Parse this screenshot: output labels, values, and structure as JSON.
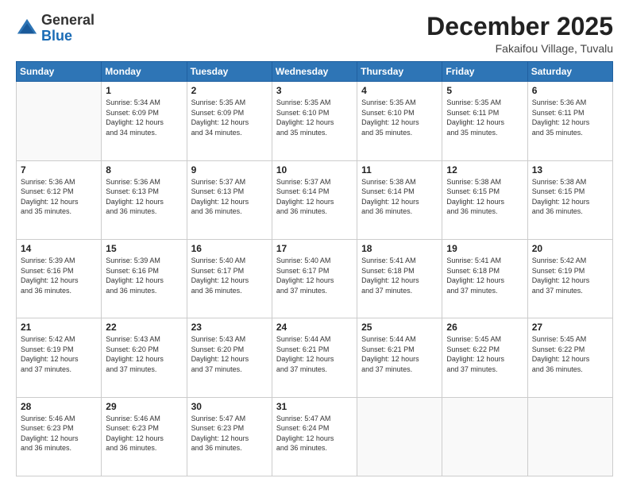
{
  "logo": {
    "general": "General",
    "blue": "Blue"
  },
  "header": {
    "month": "December 2025",
    "location": "Fakaifou Village, Tuvalu"
  },
  "weekdays": [
    "Sunday",
    "Monday",
    "Tuesday",
    "Wednesday",
    "Thursday",
    "Friday",
    "Saturday"
  ],
  "weeks": [
    [
      {
        "day": "",
        "info": ""
      },
      {
        "day": "1",
        "info": "Sunrise: 5:34 AM\nSunset: 6:09 PM\nDaylight: 12 hours\nand 34 minutes."
      },
      {
        "day": "2",
        "info": "Sunrise: 5:35 AM\nSunset: 6:09 PM\nDaylight: 12 hours\nand 34 minutes."
      },
      {
        "day": "3",
        "info": "Sunrise: 5:35 AM\nSunset: 6:10 PM\nDaylight: 12 hours\nand 35 minutes."
      },
      {
        "day": "4",
        "info": "Sunrise: 5:35 AM\nSunset: 6:10 PM\nDaylight: 12 hours\nand 35 minutes."
      },
      {
        "day": "5",
        "info": "Sunrise: 5:35 AM\nSunset: 6:11 PM\nDaylight: 12 hours\nand 35 minutes."
      },
      {
        "day": "6",
        "info": "Sunrise: 5:36 AM\nSunset: 6:11 PM\nDaylight: 12 hours\nand 35 minutes."
      }
    ],
    [
      {
        "day": "7",
        "info": "Sunrise: 5:36 AM\nSunset: 6:12 PM\nDaylight: 12 hours\nand 35 minutes."
      },
      {
        "day": "8",
        "info": "Sunrise: 5:36 AM\nSunset: 6:13 PM\nDaylight: 12 hours\nand 36 minutes."
      },
      {
        "day": "9",
        "info": "Sunrise: 5:37 AM\nSunset: 6:13 PM\nDaylight: 12 hours\nand 36 minutes."
      },
      {
        "day": "10",
        "info": "Sunrise: 5:37 AM\nSunset: 6:14 PM\nDaylight: 12 hours\nand 36 minutes."
      },
      {
        "day": "11",
        "info": "Sunrise: 5:38 AM\nSunset: 6:14 PM\nDaylight: 12 hours\nand 36 minutes."
      },
      {
        "day": "12",
        "info": "Sunrise: 5:38 AM\nSunset: 6:15 PM\nDaylight: 12 hours\nand 36 minutes."
      },
      {
        "day": "13",
        "info": "Sunrise: 5:38 AM\nSunset: 6:15 PM\nDaylight: 12 hours\nand 36 minutes."
      }
    ],
    [
      {
        "day": "14",
        "info": "Sunrise: 5:39 AM\nSunset: 6:16 PM\nDaylight: 12 hours\nand 36 minutes."
      },
      {
        "day": "15",
        "info": "Sunrise: 5:39 AM\nSunset: 6:16 PM\nDaylight: 12 hours\nand 36 minutes."
      },
      {
        "day": "16",
        "info": "Sunrise: 5:40 AM\nSunset: 6:17 PM\nDaylight: 12 hours\nand 36 minutes."
      },
      {
        "day": "17",
        "info": "Sunrise: 5:40 AM\nSunset: 6:17 PM\nDaylight: 12 hours\nand 37 minutes."
      },
      {
        "day": "18",
        "info": "Sunrise: 5:41 AM\nSunset: 6:18 PM\nDaylight: 12 hours\nand 37 minutes."
      },
      {
        "day": "19",
        "info": "Sunrise: 5:41 AM\nSunset: 6:18 PM\nDaylight: 12 hours\nand 37 minutes."
      },
      {
        "day": "20",
        "info": "Sunrise: 5:42 AM\nSunset: 6:19 PM\nDaylight: 12 hours\nand 37 minutes."
      }
    ],
    [
      {
        "day": "21",
        "info": "Sunrise: 5:42 AM\nSunset: 6:19 PM\nDaylight: 12 hours\nand 37 minutes."
      },
      {
        "day": "22",
        "info": "Sunrise: 5:43 AM\nSunset: 6:20 PM\nDaylight: 12 hours\nand 37 minutes."
      },
      {
        "day": "23",
        "info": "Sunrise: 5:43 AM\nSunset: 6:20 PM\nDaylight: 12 hours\nand 37 minutes."
      },
      {
        "day": "24",
        "info": "Sunrise: 5:44 AM\nSunset: 6:21 PM\nDaylight: 12 hours\nand 37 minutes."
      },
      {
        "day": "25",
        "info": "Sunrise: 5:44 AM\nSunset: 6:21 PM\nDaylight: 12 hours\nand 37 minutes."
      },
      {
        "day": "26",
        "info": "Sunrise: 5:45 AM\nSunset: 6:22 PM\nDaylight: 12 hours\nand 37 minutes."
      },
      {
        "day": "27",
        "info": "Sunrise: 5:45 AM\nSunset: 6:22 PM\nDaylight: 12 hours\nand 36 minutes."
      }
    ],
    [
      {
        "day": "28",
        "info": "Sunrise: 5:46 AM\nSunset: 6:23 PM\nDaylight: 12 hours\nand 36 minutes."
      },
      {
        "day": "29",
        "info": "Sunrise: 5:46 AM\nSunset: 6:23 PM\nDaylight: 12 hours\nand 36 minutes."
      },
      {
        "day": "30",
        "info": "Sunrise: 5:47 AM\nSunset: 6:23 PM\nDaylight: 12 hours\nand 36 minutes."
      },
      {
        "day": "31",
        "info": "Sunrise: 5:47 AM\nSunset: 6:24 PM\nDaylight: 12 hours\nand 36 minutes."
      },
      {
        "day": "",
        "info": ""
      },
      {
        "day": "",
        "info": ""
      },
      {
        "day": "",
        "info": ""
      }
    ]
  ]
}
